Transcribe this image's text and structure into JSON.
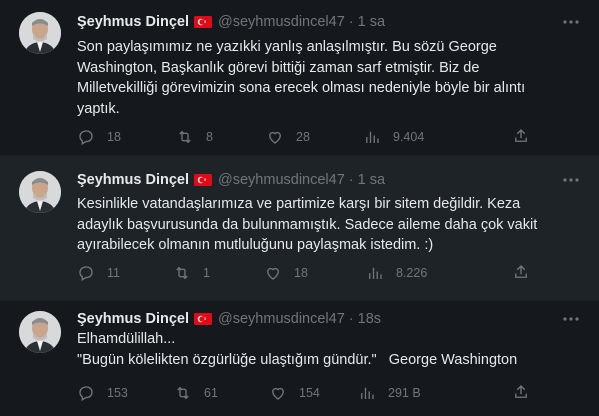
{
  "author": {
    "name": "Şeyhmus Dinçel",
    "handle": "@seyhmusdincel47",
    "flag": "turkey-flag"
  },
  "colors": {
    "background": "#15181c",
    "highlight": "#1e2328",
    "muted": "#71767b",
    "text": "#e7e9ea"
  },
  "tweets": [
    {
      "time": "1 sa",
      "lines": [
        "Son paylaşımımız ne yazıkki yanlış anlaşılmıştır. Bu sözü George",
        "Washington, Başkanlık görevi bittiği zaman sarf etmiştir. Biz de",
        "Milletvekilliği görevimizin sona erecek olması nedeniyle böyle bir alıntı",
        "yaptık."
      ],
      "replies": "18",
      "retweets": "8",
      "likes": "28",
      "views": "9.404"
    },
    {
      "time": "1 sa",
      "lines": [
        "Kesinlikle vatandaşlarımıza ve partimize karşı bir sitem değildir. Keza",
        "adaylık başvurusunda da bulunmamıştık. Sadece aileme daha çok vakit",
        "ayırabilecek olmanın mutluluğunu paylaşmak istedim. :)"
      ],
      "replies": "11",
      "retweets": "1",
      "likes": "18",
      "views": "8.226"
    },
    {
      "time": "18s",
      "lines": [
        "Elhamdülillah...",
        "\"Bugün kölelikten özgürlüğe ulaştığım gündür.\"   George Washington"
      ],
      "replies": "153",
      "retweets": "61",
      "likes": "154",
      "views": "291 B"
    }
  ],
  "icons": [
    "avatar",
    "turkey-flag",
    "more-icon",
    "reply-icon",
    "retweet-icon",
    "like-icon",
    "views-icon",
    "share-icon"
  ]
}
